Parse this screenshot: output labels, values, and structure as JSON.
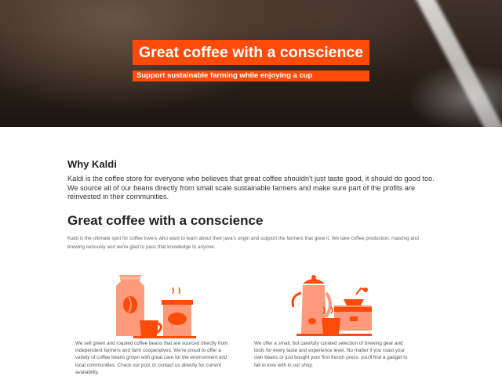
{
  "hero": {
    "title": "Great coffee with a conscience",
    "subtitle": "Support sustainable farming while enjoying a cup"
  },
  "why": {
    "heading": "Why Kaldi",
    "text": "Kaldi is the coffee store for everyone who believes that great coffee shouldn't just taste good, it should do good too. We source all of our beans directly from small scale sustainable farmers and make sure part of the profits are reinvested in their communities."
  },
  "main": {
    "heading": "Great coffee with a conscience",
    "intro": "Kaldi is the ultimate spot for coffee lovers who want to learn about their java's origin and support the farmers that grew it. We take coffee production, roasting and brewing seriously and we're glad to pass that knowledge to anyone."
  },
  "columns": [
    {
      "icon": "coffee-beans-bag-illustration",
      "text": "We sell green and roasted coffee beans that are sourced directly from independent farmers and farm cooperatives. We're proud to offer a variety of coffee beans grown with great care for the environment and local communities. Check our post or contact us directly for current availability."
    },
    {
      "icon": "brewing-gear-illustration",
      "text": "We offer a small, but carefully curated selection of brewing gear and tools for every taste and experience level. No matter if you roast your own beans or just bought your first french press, you'll find a gadget to fall in love with in our shop."
    }
  ],
  "colors": {
    "accent": "#ff4b0a",
    "illustration_light": "#ff9a7a",
    "illustration_dark": "#ff4b0a"
  }
}
